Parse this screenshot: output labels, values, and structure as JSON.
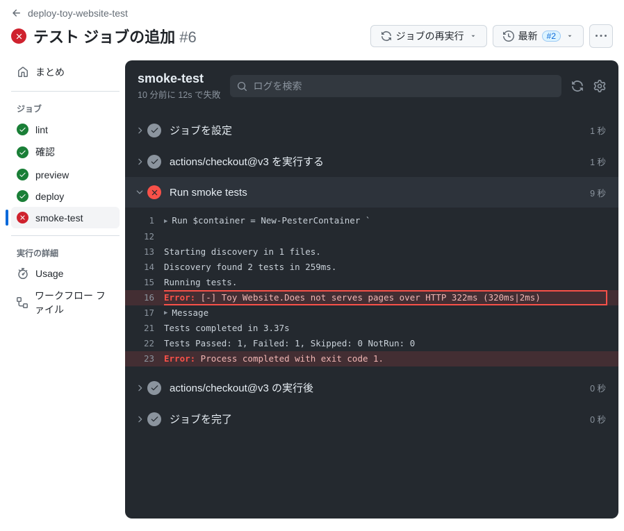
{
  "breadcrumb": {
    "label": "deploy-toy-website-test"
  },
  "page": {
    "title": "テスト ジョブの追加",
    "number": "#6"
  },
  "toolbar": {
    "rerun": "ジョブの再実行",
    "latest": "最新",
    "latest_badge": "#2"
  },
  "sidebar": {
    "summary": "まとめ",
    "jobs_heading": "ジョブ",
    "jobs": [
      {
        "label": "lint",
        "status": "ok"
      },
      {
        "label": "確認",
        "status": "ok"
      },
      {
        "label": "preview",
        "status": "ok"
      },
      {
        "label": "deploy",
        "status": "ok"
      },
      {
        "label": "smoke-test",
        "status": "fail"
      }
    ],
    "details_heading": "実行の詳細",
    "usage": "Usage",
    "workflow_file": "ワークフロー ファイル"
  },
  "log": {
    "title": "smoke-test",
    "subtitle": "10 分前に 12s で失敗",
    "search_placeholder": "ログを検索",
    "steps_before": [
      {
        "name": "ジョブを設定",
        "time": "1 秒",
        "status": "ok"
      },
      {
        "name": "actions/checkout@v3 を実行する",
        "time": "1 秒",
        "status": "ok"
      }
    ],
    "expanded_step": {
      "name": "Run smoke tests",
      "time": "9 秒",
      "status": "fail"
    },
    "lines": [
      {
        "n": "1",
        "disclose": true,
        "text": "Run $container = New-PesterContainer `"
      },
      {
        "n": "12",
        "text": ""
      },
      {
        "n": "13",
        "text": "Starting discovery in 1 files."
      },
      {
        "n": "14",
        "text": "Discovery found 2 tests in 259ms."
      },
      {
        "n": "15",
        "text": "Running tests."
      },
      {
        "n": "16",
        "err": true,
        "boxed": true,
        "label": "Error:",
        "text": " [-] Toy Website.Does not serves pages over HTTP 322ms (320ms|2ms)"
      },
      {
        "n": "17",
        "disclose": true,
        "text": "Message"
      },
      {
        "n": "21",
        "text": "Tests completed in 3.37s"
      },
      {
        "n": "22",
        "text": "Tests Passed: 1, Failed: 1, Skipped: 0 NotRun: 0"
      },
      {
        "n": "23",
        "err": true,
        "label": "Error:",
        "text": " Process completed with exit code 1."
      }
    ],
    "steps_after": [
      {
        "name": "actions/checkout@v3 の実行後",
        "time": "0 秒",
        "status": "ok"
      },
      {
        "name": "ジョブを完了",
        "time": "0 秒",
        "status": "ok"
      }
    ]
  }
}
